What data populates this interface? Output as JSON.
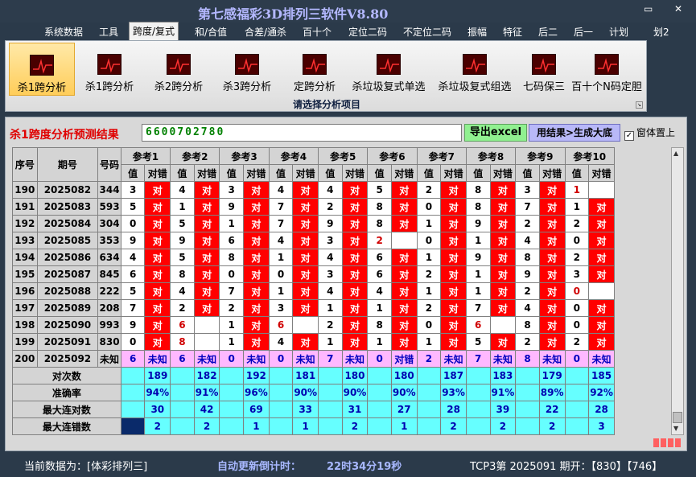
{
  "window": {
    "title": "第七感福彩3D排列三软件V8.80",
    "restore_glyph": "▭",
    "close_glyph": "✕"
  },
  "menu": [
    "系统数据",
    "工具",
    "跨度/复式",
    "和/合值",
    "合差/通杀",
    "百十个",
    "定位二码",
    "不定位二码",
    "振幅",
    "特征",
    "后二",
    "后一",
    "计划",
    "划2"
  ],
  "menu_active_index": 2,
  "ribbon": {
    "buttons": [
      "杀1跨分析",
      "杀1跨分析",
      "杀2跨分析",
      "杀3跨分析",
      "定跨分析",
      "杀垃圾复式单选",
      "杀垃圾复式组选",
      "七码保三",
      "百十个N码定胆"
    ],
    "active_index": 0,
    "caption": "请选择分析项目",
    "corner_glyph": "↘"
  },
  "result": {
    "title": "杀1跨度分析预测结果",
    "value": "6600702780",
    "excel_button": "导出excel",
    "generate_button": "用结果>生成大底",
    "checkbox_label": "窗体置上",
    "checkbox_checked": "✓"
  },
  "table": {
    "h_seq": "序号",
    "h_issue": "期号",
    "h_num": "号码",
    "refs": [
      "参考1",
      "参考2",
      "参考3",
      "参考4",
      "参考5",
      "参考6",
      "参考7",
      "参考8",
      "参考9",
      "参考10"
    ],
    "sub_val": "值",
    "sub_res": "对错",
    "rows": [
      {
        "seq": "190",
        "issue": "2025082",
        "num": "344",
        "cells": [
          [
            "3",
            "对"
          ],
          [
            "4",
            "对"
          ],
          [
            "3",
            "对"
          ],
          [
            "4",
            "对"
          ],
          [
            "4",
            "对"
          ],
          [
            "5",
            "对"
          ],
          [
            "2",
            "对"
          ],
          [
            "8",
            "对"
          ],
          [
            "3",
            "对"
          ],
          [
            "1",
            ""
          ]
        ]
      },
      {
        "seq": "191",
        "issue": "2025083",
        "num": "593",
        "cells": [
          [
            "5",
            "对"
          ],
          [
            "1",
            "对"
          ],
          [
            "9",
            "对"
          ],
          [
            "7",
            "对"
          ],
          [
            "2",
            "对"
          ],
          [
            "8",
            "对"
          ],
          [
            "0",
            "对"
          ],
          [
            "8",
            "对"
          ],
          [
            "7",
            "对"
          ],
          [
            "1",
            "对"
          ]
        ]
      },
      {
        "seq": "192",
        "issue": "2025084",
        "num": "304",
        "cells": [
          [
            "0",
            "对"
          ],
          [
            "5",
            "对"
          ],
          [
            "1",
            "对"
          ],
          [
            "7",
            "对"
          ],
          [
            "9",
            "对"
          ],
          [
            "8",
            "对"
          ],
          [
            "1",
            "对"
          ],
          [
            "9",
            "对"
          ],
          [
            "2",
            "对"
          ],
          [
            "2",
            "对"
          ]
        ]
      },
      {
        "seq": "193",
        "issue": "2025085",
        "num": "353",
        "cells": [
          [
            "9",
            "对"
          ],
          [
            "9",
            "对"
          ],
          [
            "6",
            "对"
          ],
          [
            "4",
            "对"
          ],
          [
            "3",
            "对"
          ],
          [
            "2",
            ""
          ],
          [
            "0",
            "对"
          ],
          [
            "1",
            "对"
          ],
          [
            "4",
            "对"
          ],
          [
            "0",
            "对"
          ]
        ]
      },
      {
        "seq": "194",
        "issue": "2025086",
        "num": "634",
        "cells": [
          [
            "4",
            "对"
          ],
          [
            "5",
            "对"
          ],
          [
            "8",
            "对"
          ],
          [
            "1",
            "对"
          ],
          [
            "4",
            "对"
          ],
          [
            "6",
            "对"
          ],
          [
            "1",
            "对"
          ],
          [
            "9",
            "对"
          ],
          [
            "8",
            "对"
          ],
          [
            "2",
            "对"
          ]
        ]
      },
      {
        "seq": "195",
        "issue": "2025087",
        "num": "845",
        "cells": [
          [
            "6",
            "对"
          ],
          [
            "8",
            "对"
          ],
          [
            "0",
            "对"
          ],
          [
            "0",
            "对"
          ],
          [
            "3",
            "对"
          ],
          [
            "6",
            "对"
          ],
          [
            "2",
            "对"
          ],
          [
            "1",
            "对"
          ],
          [
            "9",
            "对"
          ],
          [
            "3",
            "对"
          ]
        ]
      },
      {
        "seq": "196",
        "issue": "2025088",
        "num": "222",
        "cells": [
          [
            "5",
            "对"
          ],
          [
            "4",
            "对"
          ],
          [
            "7",
            "对"
          ],
          [
            "1",
            "对"
          ],
          [
            "4",
            "对"
          ],
          [
            "4",
            "对"
          ],
          [
            "1",
            "对"
          ],
          [
            "1",
            "对"
          ],
          [
            "2",
            "对"
          ],
          [
            "0",
            ""
          ]
        ]
      },
      {
        "seq": "197",
        "issue": "2025089",
        "num": "208",
        "cells": [
          [
            "7",
            "对"
          ],
          [
            "2",
            "对"
          ],
          [
            "2",
            "对"
          ],
          [
            "3",
            "对"
          ],
          [
            "1",
            "对"
          ],
          [
            "1",
            "对"
          ],
          [
            "2",
            "对"
          ],
          [
            "7",
            "对"
          ],
          [
            "4",
            "对"
          ],
          [
            "0",
            "对"
          ]
        ]
      },
      {
        "seq": "198",
        "issue": "2025090",
        "num": "993",
        "cells": [
          [
            "9",
            "对"
          ],
          [
            "6",
            ""
          ],
          [
            "1",
            "对"
          ],
          [
            "6",
            ""
          ],
          [
            "2",
            "对"
          ],
          [
            "8",
            "对"
          ],
          [
            "0",
            "对"
          ],
          [
            "6",
            ""
          ],
          [
            "8",
            "对"
          ],
          [
            "0",
            "对"
          ]
        ]
      },
      {
        "seq": "199",
        "issue": "2025091",
        "num": "830",
        "cells": [
          [
            "0",
            "对"
          ],
          [
            "8",
            ""
          ],
          [
            "1",
            "对"
          ],
          [
            "4",
            "对"
          ],
          [
            "1",
            "对"
          ],
          [
            "1",
            "对"
          ],
          [
            "1",
            "对"
          ],
          [
            "5",
            "对"
          ],
          [
            "2",
            "对"
          ],
          [
            "2",
            "对"
          ]
        ]
      }
    ],
    "red_texts": [
      "2,5",
      "0,9",
      "1,1",
      "3,1",
      "3,7"
    ],
    "pred_row": {
      "seq": "200",
      "issue": "2025092",
      "num": "未知",
      "cells": [
        [
          "6",
          "未知"
        ],
        [
          "6",
          "未知"
        ],
        [
          "0",
          "未知"
        ],
        [
          "0",
          "未知"
        ],
        [
          "7",
          "未知"
        ],
        [
          "0",
          "对错"
        ],
        [
          "2",
          "未知"
        ],
        [
          "7",
          "未知"
        ],
        [
          "8",
          "未知"
        ],
        [
          "0",
          "未知"
        ]
      ]
    },
    "stats": [
      {
        "label": "对次数",
        "values": [
          "189",
          "182",
          "192",
          "181",
          "180",
          "180",
          "187",
          "183",
          "179",
          "185"
        ]
      },
      {
        "label": "准确率",
        "values": [
          "94%",
          "91%",
          "96%",
          "90%",
          "90%",
          "90%",
          "93%",
          "91%",
          "89%",
          "92%"
        ]
      },
      {
        "label": "最大连对数",
        "values": [
          "30",
          "42",
          "69",
          "33",
          "31",
          "27",
          "28",
          "39",
          "22",
          "28"
        ]
      },
      {
        "label": "最大连错数",
        "values": [
          "2",
          "2",
          "1",
          "1",
          "2",
          "1",
          "2",
          "2",
          "2",
          "3"
        ]
      }
    ]
  },
  "status": {
    "current": "当前数据为：[体彩排列三]",
    "countdown_label": "自动更新倒计时：",
    "countdown": "22时34分19秒",
    "tcp": "TCP3第 2025091 期开：【830】【746】"
  },
  "colors": {
    "accent_red": "#ff0000",
    "stat_cyan": "#66ffff",
    "pred_pink": "#ffb8ff"
  }
}
